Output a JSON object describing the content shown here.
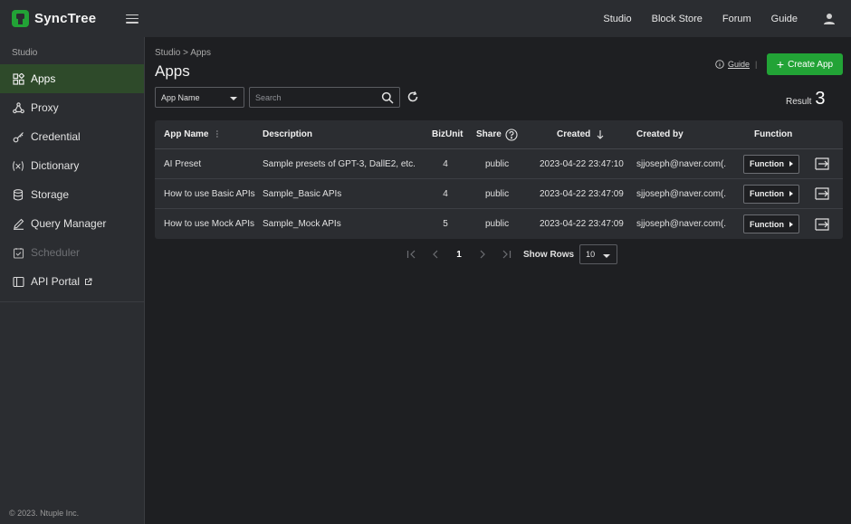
{
  "app": {
    "name": "SyncTree",
    "brand_color": "#22a336"
  },
  "topnav": {
    "links": [
      "Studio",
      "Block Store",
      "Forum",
      "Guide"
    ]
  },
  "sidebar": {
    "section": "Studio",
    "items": [
      {
        "label": "Apps",
        "icon": "apps-icon",
        "state": "active"
      },
      {
        "label": "Proxy",
        "icon": "proxy-icon",
        "state": "normal"
      },
      {
        "label": "Credential",
        "icon": "key-icon",
        "state": "normal"
      },
      {
        "label": "Dictionary",
        "icon": "variable-icon",
        "state": "normal"
      },
      {
        "label": "Storage",
        "icon": "database-icon",
        "state": "normal"
      },
      {
        "label": "Query Manager",
        "icon": "pencil-icon",
        "state": "normal"
      },
      {
        "label": "Scheduler",
        "icon": "calendar-check-icon",
        "state": "disabled"
      },
      {
        "label": "API Portal",
        "icon": "portal-icon",
        "state": "normal",
        "external": true
      }
    ],
    "copyright": "© 2023. Ntuple Inc."
  },
  "main": {
    "breadcrumb": "Studio > Apps",
    "title": "Apps",
    "guide_label": "Guide",
    "guide_sep": "|",
    "create_label": "Create App",
    "filter": {
      "selected": "App Name"
    },
    "search": {
      "placeholder": "Search",
      "value": ""
    },
    "result": {
      "label": "Result",
      "count": "3"
    },
    "table": {
      "headers": {
        "name": "App Name",
        "desc": "Description",
        "biz": "BizUnit",
        "share": "Share",
        "created": "Created",
        "created_by": "Created by",
        "function": "Function"
      },
      "rows": [
        {
          "name": "AI Preset",
          "desc": "Sample presets of GPT-3, DallE2, etc.",
          "biz": "4",
          "share": "public",
          "created": "2023-04-22 23:47:10",
          "by": "sjjoseph@naver.com(...",
          "func": "Function"
        },
        {
          "name": "How to use Basic APIs",
          "desc": "Sample_Basic APIs",
          "biz": "4",
          "share": "public",
          "created": "2023-04-22 23:47:09",
          "by": "sjjoseph@naver.com(...",
          "func": "Function"
        },
        {
          "name": "How to use Mock APIs",
          "desc": "Sample_Mock APIs",
          "biz": "5",
          "share": "public",
          "created": "2023-04-22 23:47:09",
          "by": "sjjoseph@naver.com(...",
          "func": "Function"
        }
      ]
    },
    "pagination": {
      "current": "1",
      "rows_label": "Show Rows",
      "rows_value": "10"
    }
  }
}
